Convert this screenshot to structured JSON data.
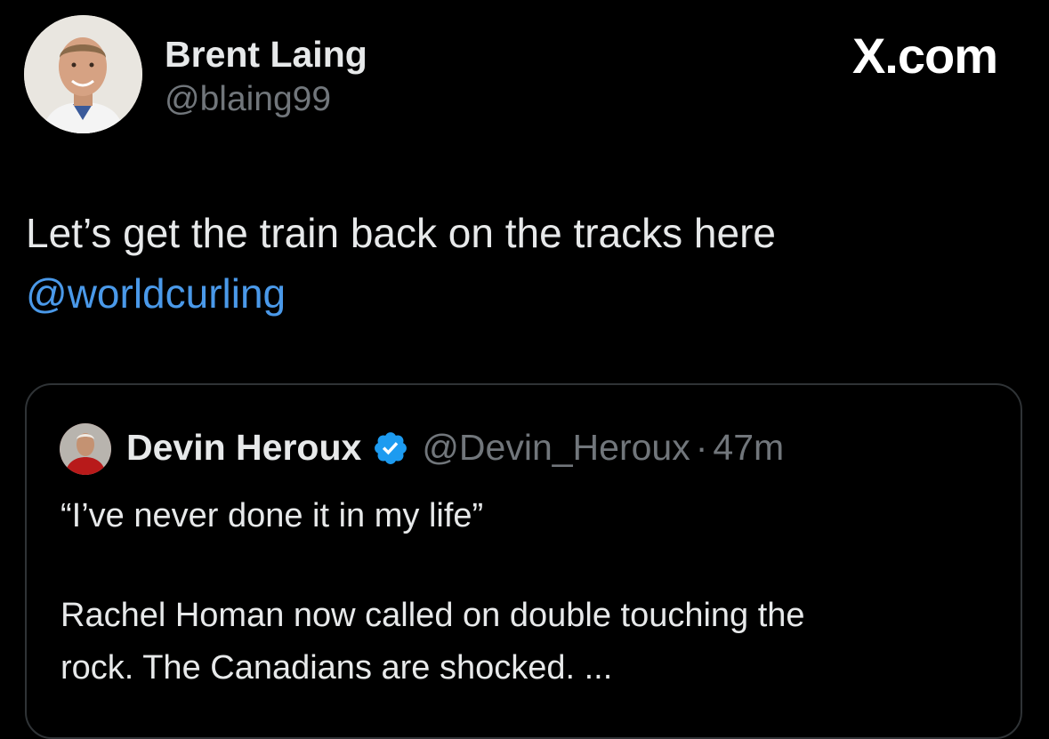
{
  "site": "X.com",
  "author": {
    "name": "Brent Laing",
    "handle": "@blaing99"
  },
  "tweet": {
    "text": "Let’s get the train back on the tracks here",
    "mention": "@worldcurling"
  },
  "quoted": {
    "name": "Devin Heroux",
    "handle": "@Devin_Heroux",
    "separator": "·",
    "time": "47m",
    "line1": "“I’ve never done it in my life”",
    "line2": "Rachel Homan now called on double touching the",
    "line3": "rock. The Canadians are shocked. ..."
  },
  "colors": {
    "background": "#000000",
    "text": "#e7e9ea",
    "secondary": "#71767b",
    "mention": "#4a99e9",
    "verified": "#1d9bf0",
    "card_border": "#2f3336"
  },
  "icons": {
    "verified": "verified-badge-icon"
  }
}
